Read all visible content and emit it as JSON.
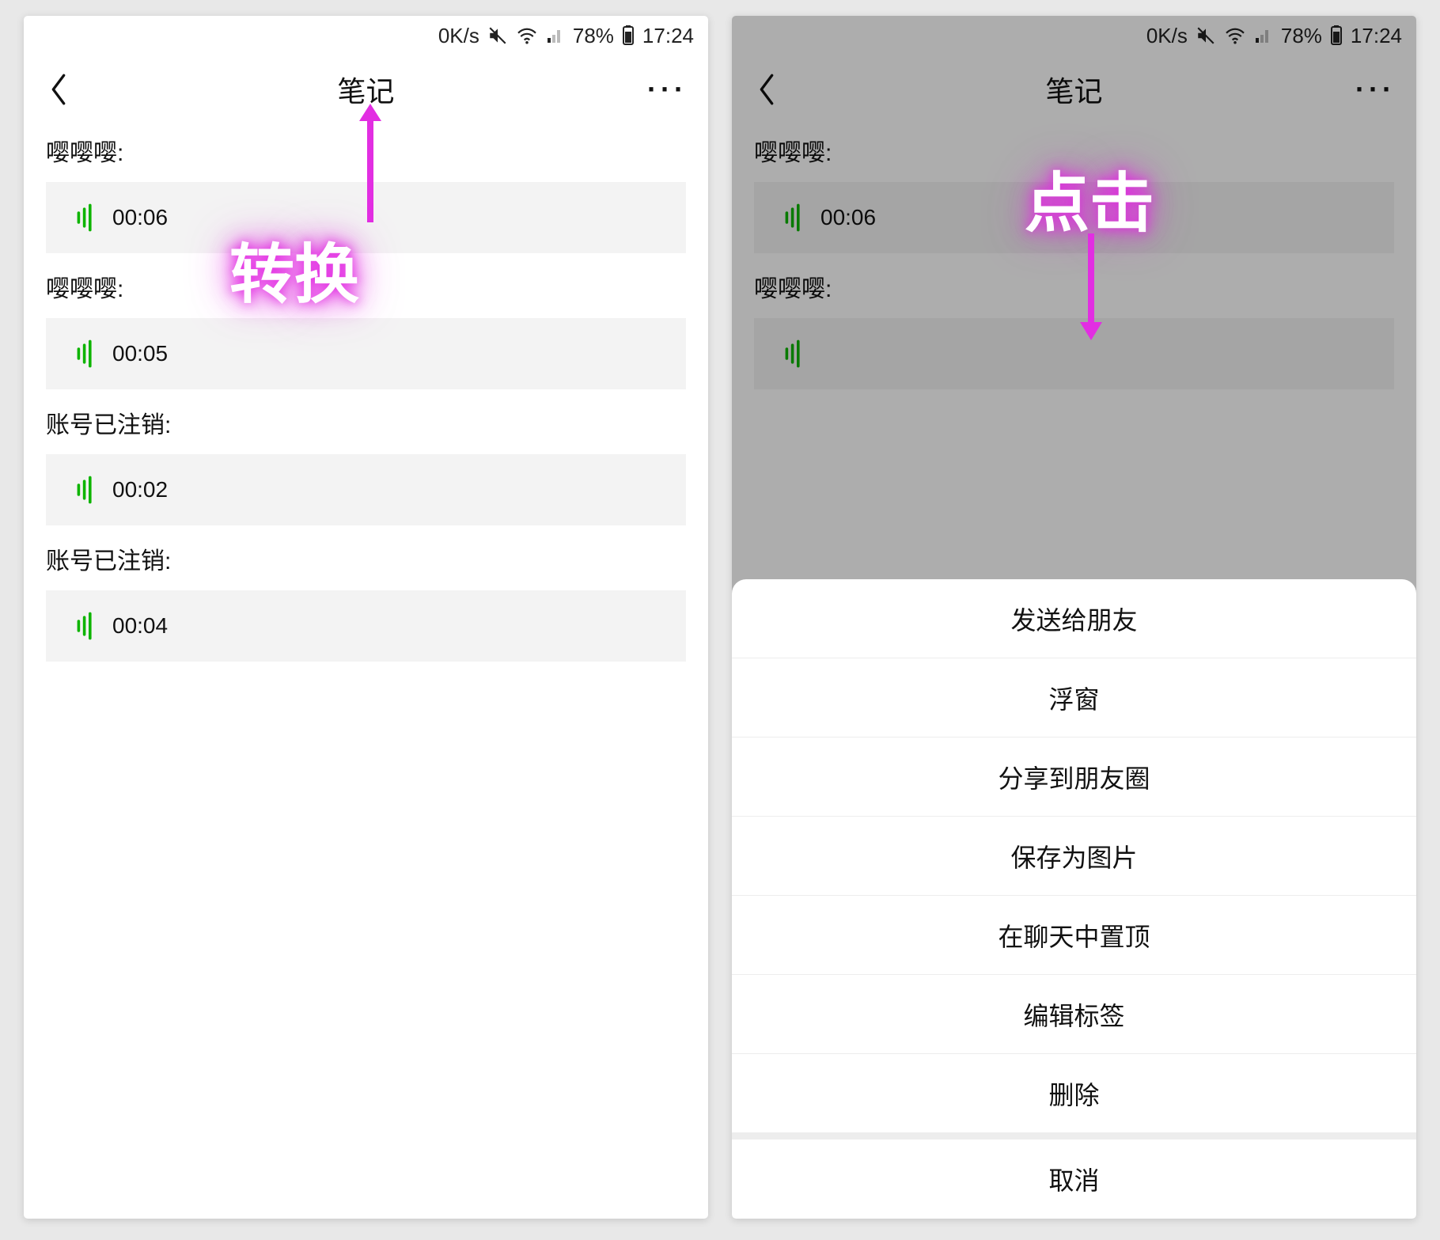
{
  "statusbar": {
    "speed": "0K/s",
    "battery": "78%",
    "time": "17:24"
  },
  "navbar": {
    "title": "笔记",
    "more": "···"
  },
  "entries": [
    {
      "label": "嘤嘤嘤:",
      "dur": "00:06"
    },
    {
      "label": "嘤嘤嘤:",
      "dur": "00:05"
    },
    {
      "label": "账号已注销:",
      "dur": "00:02"
    },
    {
      "label": "账号已注销:",
      "dur": "00:04"
    }
  ],
  "sheet": {
    "options": [
      "发送给朋友",
      "浮窗",
      "分享到朋友圈",
      "保存为图片",
      "在聊天中置顶",
      "编辑标签",
      "删除",
      "取消"
    ]
  },
  "annot": {
    "left": "转换",
    "right": "点击"
  },
  "phone2_entries_visible": [
    {
      "label": "嘤嘤嘤:",
      "dur": "00:06"
    },
    {
      "label": "嘤嘤嘤:",
      "dur": ""
    }
  ]
}
